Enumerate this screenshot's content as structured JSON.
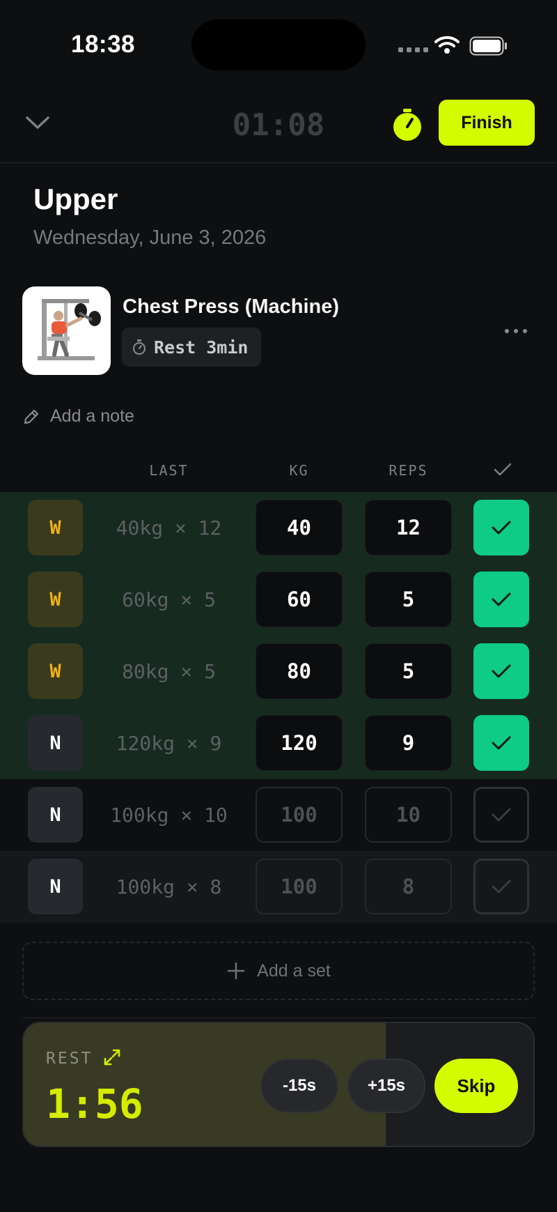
{
  "status_bar": {
    "time": "18:38"
  },
  "header": {
    "elapsed": "01:08",
    "finish_label": "Finish"
  },
  "workout": {
    "title": "Upper",
    "date": "Wednesday, June 3, 2026"
  },
  "exercise": {
    "name": "Chest Press (Machine)",
    "rest_label": "Rest 3min",
    "note_placeholder": "Add a note"
  },
  "table": {
    "headers": {
      "last": "LAST",
      "kg": "KG",
      "reps": "REPS"
    },
    "rows": [
      {
        "type": "W",
        "last": "40kg × 12",
        "kg": "40",
        "reps": "12",
        "done": true
      },
      {
        "type": "W",
        "last": "60kg × 5",
        "kg": "60",
        "reps": "5",
        "done": true
      },
      {
        "type": "W",
        "last": "80kg × 5",
        "kg": "80",
        "reps": "5",
        "done": true
      },
      {
        "type": "N",
        "last": "120kg × 9",
        "kg": "120",
        "reps": "9",
        "done": true
      },
      {
        "type": "N",
        "last": "100kg × 10",
        "kg": "100",
        "reps": "10",
        "done": false
      },
      {
        "type": "N",
        "last": "100kg × 8",
        "kg": "100",
        "reps": "8",
        "done": false
      }
    ]
  },
  "add_set_label": "Add a set",
  "rest_timer": {
    "label": "REST",
    "time": "1:56",
    "progress": 0.71,
    "minus_label": "-15s",
    "plus_label": "+15s",
    "skip_label": "Skip"
  },
  "colors": {
    "accent": "#d4fc00",
    "done_green": "#0ecb85",
    "warmup_orange": "#f0b21a",
    "completed_row_bg": "#162a20"
  }
}
